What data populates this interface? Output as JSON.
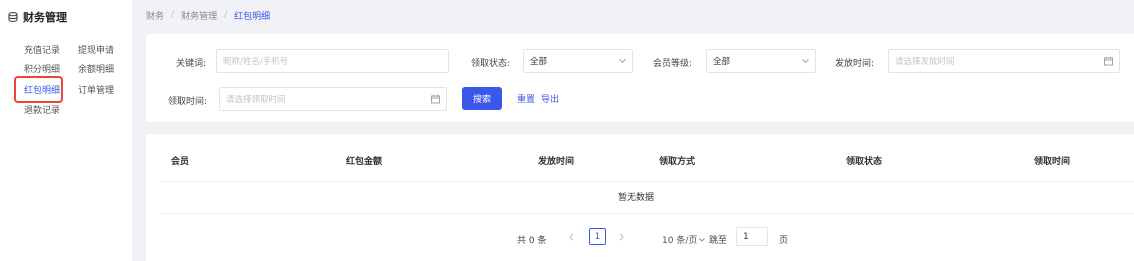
{
  "sidebar": {
    "title": "财务管理",
    "items": [
      {
        "label": "充值记录",
        "active": false
      },
      {
        "label": "提现申请",
        "active": false
      },
      {
        "label": "积分明细",
        "active": false
      },
      {
        "label": "余额明细",
        "active": false
      },
      {
        "label": "红包明细",
        "active": true
      },
      {
        "label": "订单管理",
        "active": false
      },
      {
        "label": "退款记录",
        "active": false
      }
    ]
  },
  "breadcrumb": [
    "财务",
    "财务管理",
    "红包明细"
  ],
  "breadcrumb_sep": "/",
  "filters": {
    "keyword": {
      "label": "关键词:",
      "placeholder": "昵称/姓名/手机号"
    },
    "receive_status": {
      "label": "领取状态:",
      "value": "全部"
    },
    "member_level": {
      "label": "会员等级:",
      "value": "全部"
    },
    "send_time": {
      "label": "发放时间:",
      "placeholder": "请选择发放时间"
    },
    "receive_time": {
      "label": "领取时间:",
      "placeholder": "请选择领取时间"
    },
    "search_btn": "搜索",
    "reset_btn": "重置",
    "export_btn": "导出"
  },
  "table": {
    "columns": [
      "会员",
      "红包金额",
      "发放时间",
      "领取方式",
      "领取状态",
      "领取时间"
    ],
    "rows": [],
    "empty_text": "暂无数据"
  },
  "pagination": {
    "total": "共 0 条",
    "current_page": "1",
    "page_size": "10 条/页",
    "jump_label": "跳至",
    "jump_value": "1",
    "page_unit": "页"
  },
  "colors": {
    "accent": "#3a57e8",
    "highlight": "#e8453c"
  }
}
